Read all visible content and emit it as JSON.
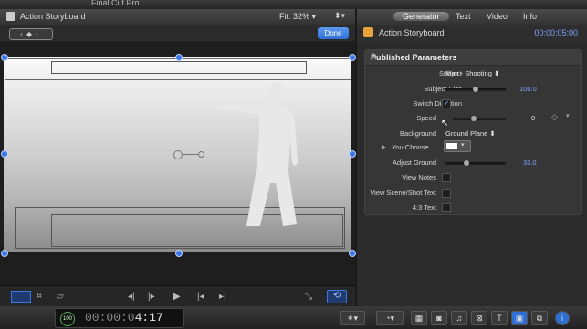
{
  "app": {
    "title": "Final Cut Pro"
  },
  "viewer": {
    "title": "Action Storyboard",
    "fit_label": "Fit:",
    "fit_value": "32%",
    "done_label": "Done"
  },
  "inspector": {
    "tabs": [
      {
        "label": "Generator",
        "active": true
      },
      {
        "label": "Text"
      },
      {
        "label": "Video"
      },
      {
        "label": "Info"
      }
    ],
    "clip_name": "Action Storyboard",
    "duration": "00:00:05:00",
    "section_title": "Published Parameters",
    "params": {
      "subject": {
        "label": "Subject",
        "value": "Man - Shooting"
      },
      "subject_size": {
        "label": "Subject Size",
        "value": "100.0",
        "level": 0.5
      },
      "switch_direction": {
        "label": "Switch Direction",
        "checked": true
      },
      "speed": {
        "label": "Speed",
        "value": "0",
        "level": 0.5
      },
      "background": {
        "label": "Background",
        "value": "Ground Plane"
      },
      "you_choose": {
        "label": "You Choose ...",
        "color": "#ffffff"
      },
      "adjust_ground": {
        "label": "Adjust Ground",
        "value": "33.0",
        "level": 0.33
      },
      "view_notes": {
        "label": "View Notes",
        "checked": false
      },
      "view_scene_shot_text": {
        "label": "View Scene/Shot Text",
        "checked": false
      },
      "aspect_text": {
        "label": "4:3 Text",
        "checked": false
      }
    }
  },
  "timecode": {
    "percent": "100",
    "dim": "00:00:0",
    "bright": "4:17"
  },
  "colors": {
    "accent": "#3b78e7",
    "timecode_blue": "#7aa6ff"
  }
}
